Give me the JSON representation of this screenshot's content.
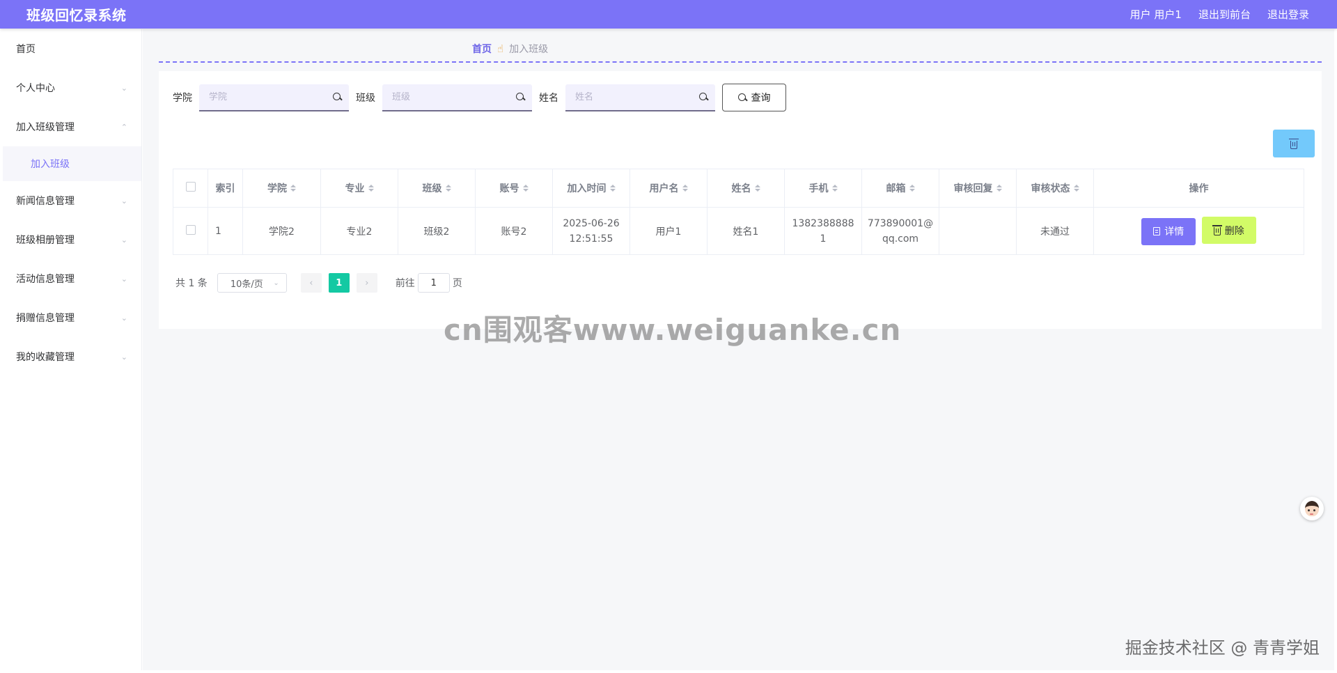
{
  "header": {
    "app_title": "班级回忆录系统",
    "user_label": "用户 用户1",
    "front_label": "退出到前台",
    "logout_label": "退出登录"
  },
  "sidebar": {
    "items": [
      {
        "label": "首页"
      },
      {
        "label": "个人中心"
      },
      {
        "label": "加入班级管理",
        "sub": "加入班级"
      },
      {
        "label": "新闻信息管理"
      },
      {
        "label": "班级相册管理"
      },
      {
        "label": "活动信息管理"
      },
      {
        "label": "捐赠信息管理"
      },
      {
        "label": "我的收藏管理"
      }
    ]
  },
  "breadcrumb": {
    "home": "首页",
    "current": "加入班级"
  },
  "search": {
    "college_label": "学院",
    "college_placeholder": "学院",
    "class_label": "班级",
    "class_placeholder": "班级",
    "name_label": "姓名",
    "name_placeholder": "姓名",
    "query_label": "查询"
  },
  "table": {
    "headers": [
      "索引",
      "学院",
      "专业",
      "班级",
      "账号",
      "加入时间",
      "用户名",
      "姓名",
      "手机",
      "邮箱",
      "审核回复",
      "审核状态",
      "操作"
    ],
    "rows": [
      {
        "index": "1",
        "college": "学院2",
        "major": "专业2",
        "class": "班级2",
        "account": "账号2",
        "join_date": "2025-06-26",
        "join_time": "12:51:55",
        "username": "用户1",
        "name": "姓名1",
        "phone_a": "1382388888",
        "phone_b": "1",
        "email_a": "773890001@",
        "email_b": "qq.com",
        "reply": "",
        "status": "未通过",
        "detail_label": "详情",
        "delete_label": "删除"
      }
    ]
  },
  "pagination": {
    "total": "共 1 条",
    "page_size": "10条/页",
    "current_page": "1",
    "jump_label": "前往",
    "jump_value": "1",
    "page_unit": "页"
  },
  "watermarks": {
    "center": "cn围观客www.weiguanke.cn",
    "bottom": "掘金技术社区 @ 青青学姐"
  },
  "colors": {
    "header": "#7b73f7",
    "accent": "#7b73f7",
    "bulk_delete": "#73c9fb",
    "delete_button": "#d2fb67",
    "active_page": "#14c9a3"
  }
}
